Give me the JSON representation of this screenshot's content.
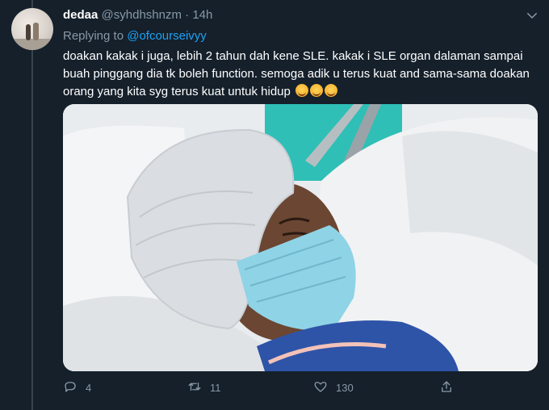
{
  "tweet": {
    "author_name": "dedaa",
    "author_handle": "@syhdhshnzm",
    "separator": "·",
    "time": "14h",
    "replying_prefix": "Replying to",
    "replying_to": "@ofcourseivyy",
    "text": "doakan kakak i juga, lebih 2 tahun dah kene SLE. kakak i SLE organ dalaman sampai buah pinggang dia tk boleh function. semoga adik u terus kuat and sama-sama doakan orang yang kita syg terus kuat untuk hidup",
    "emoji_count": 3
  },
  "actions": {
    "reply_count": "4",
    "retweet_count": "11",
    "like_count": "130"
  },
  "icons": {
    "more": "chevron-down-icon",
    "reply": "reply-icon",
    "retweet": "retweet-icon",
    "like": "heart-icon",
    "share": "share-icon"
  },
  "colors": {
    "background": "#15202b",
    "secondary_text": "#8899a6",
    "link": "#1da1f2"
  }
}
